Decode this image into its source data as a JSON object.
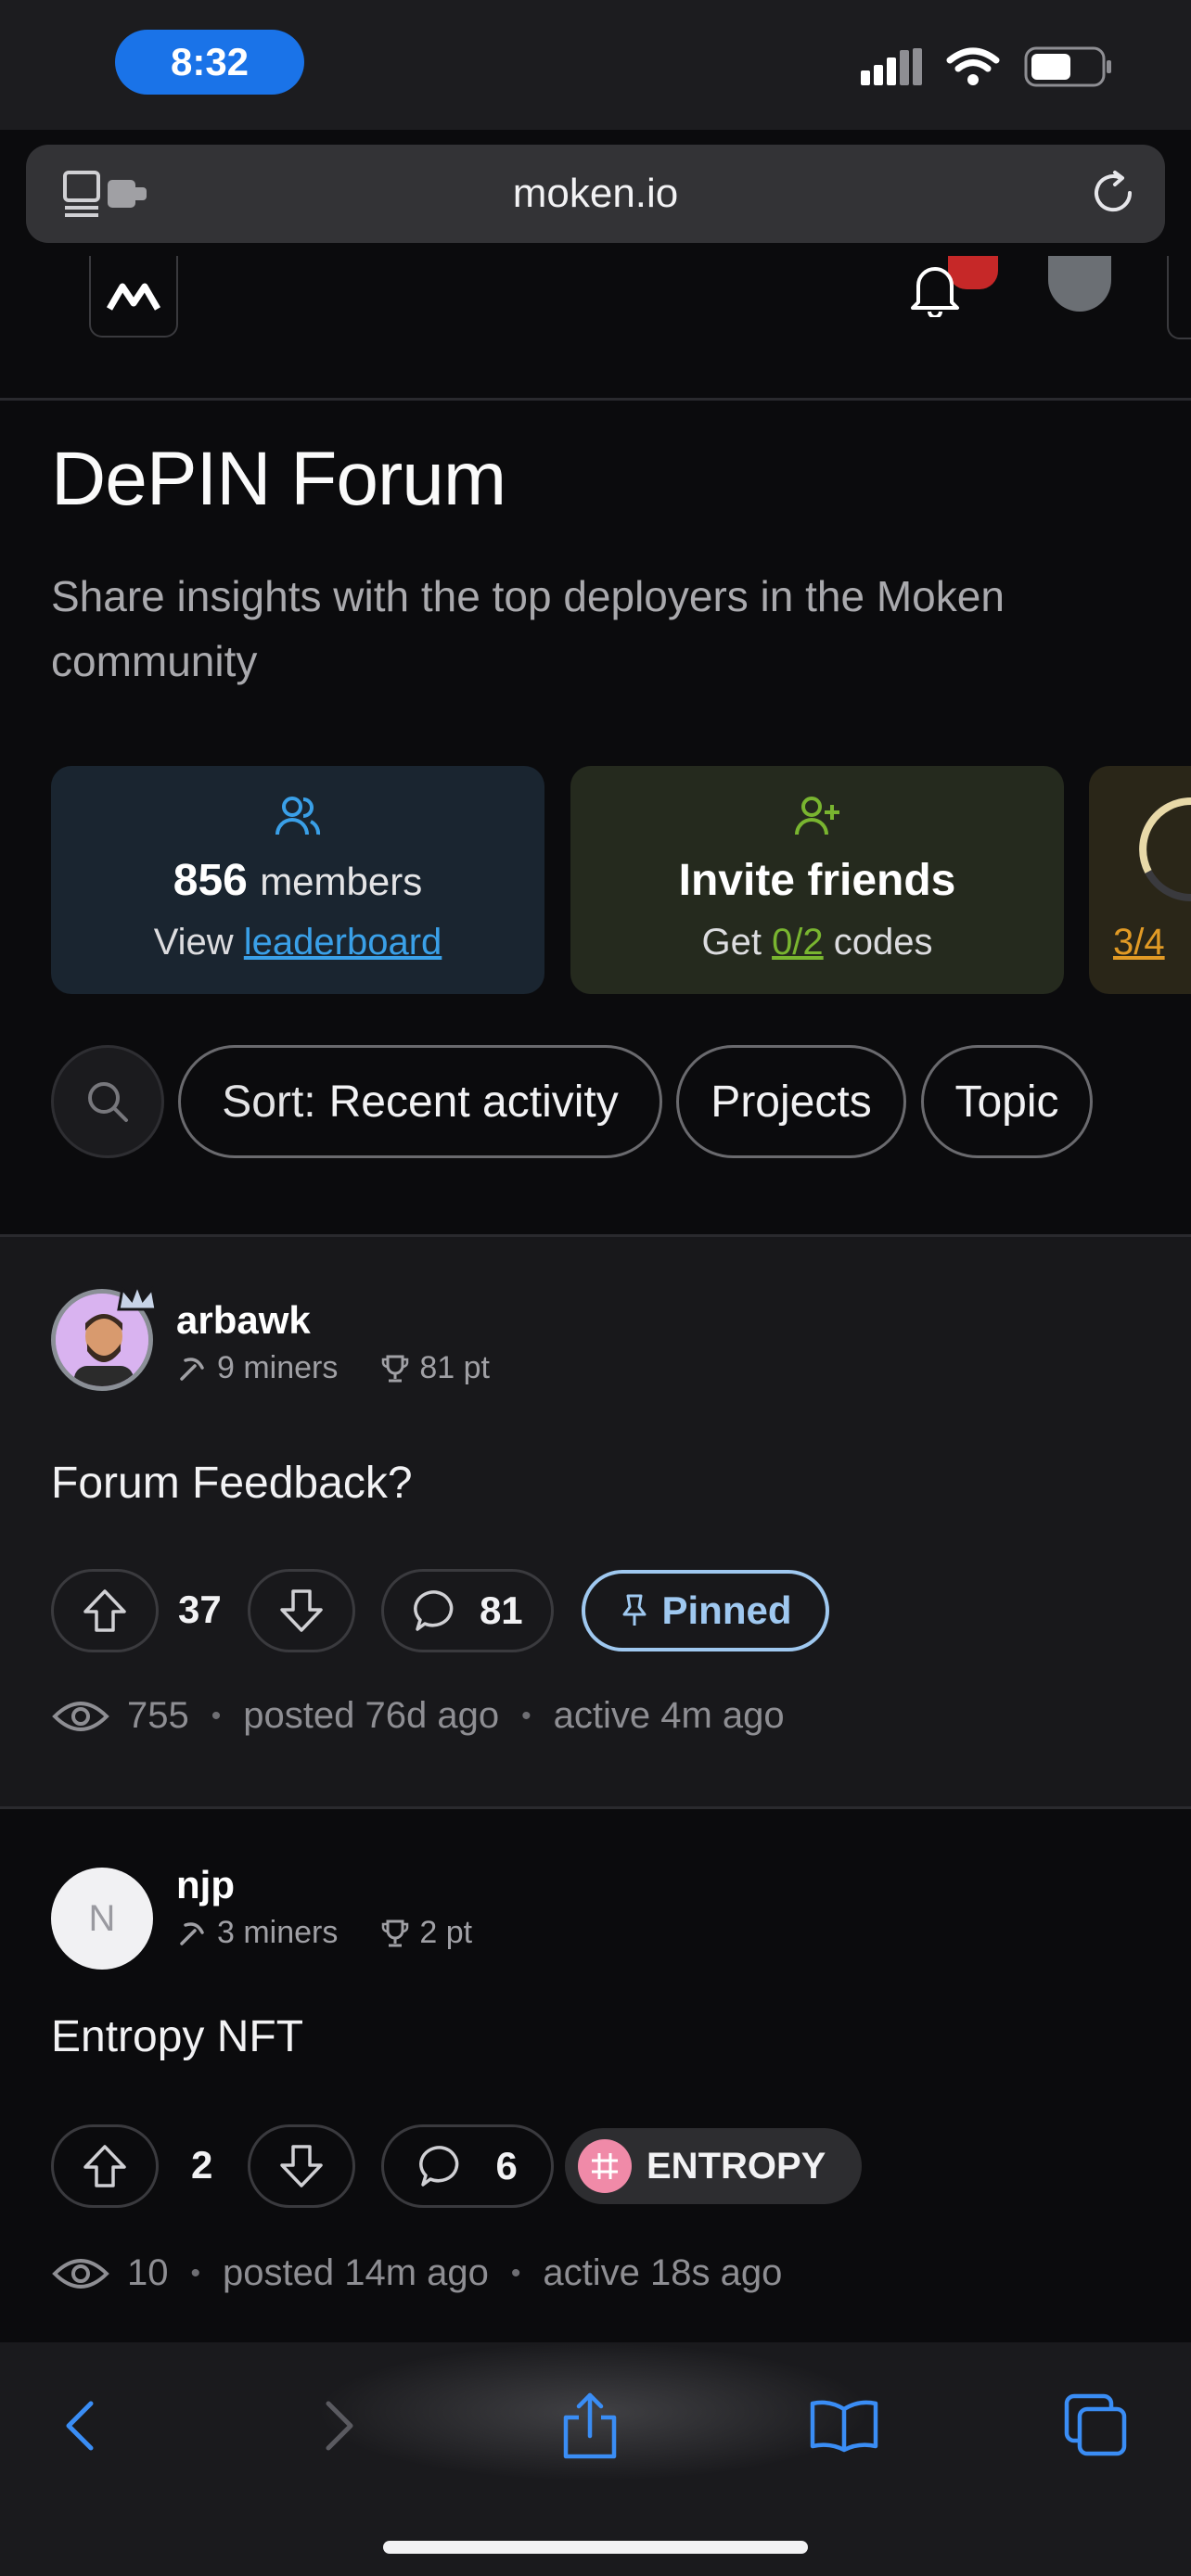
{
  "status_bar": {
    "time": "8:32"
  },
  "browser": {
    "url": "moken.io"
  },
  "page": {
    "title": "DePIN Forum",
    "subtitle": "Share insights with the top deployers in the Moken community"
  },
  "cards": {
    "members": {
      "count": "856",
      "count_label": "members",
      "view_prefix": "View",
      "link": "leaderboard"
    },
    "invite": {
      "title": "Invite friends",
      "get_prefix": "Get",
      "codes_value": "0/2",
      "codes_label": "codes"
    },
    "progress": {
      "value": "3/4"
    }
  },
  "filters": {
    "sort_label": "Sort:",
    "sort_value": "Recent activity",
    "projects": "Projects",
    "topic": "Topic"
  },
  "posts": [
    {
      "username": "arbawk",
      "miners": "9 miners",
      "points": "81 pt",
      "title": "Forum Feedback?",
      "votes": "37",
      "comments": "81",
      "tag": "Pinned",
      "views": "755",
      "posted": "posted 76d ago",
      "active": "active 4m ago"
    },
    {
      "avatar_initial": "N",
      "username": "njp",
      "miners": "3 miners",
      "points": "2 pt",
      "title": "Entropy NFT",
      "votes": "2",
      "comments": "6",
      "tag": "ENTROPY",
      "views": "10",
      "posted": "posted 14m ago",
      "active": "active 18s ago"
    }
  ],
  "colors": {
    "accent_blue": "#1a73e8",
    "link_blue": "#3aa0e8",
    "link_green": "#79b530",
    "link_orange": "#e19a25",
    "pinned": "#9fc8f0",
    "entropy_pink": "#f08aa8"
  }
}
